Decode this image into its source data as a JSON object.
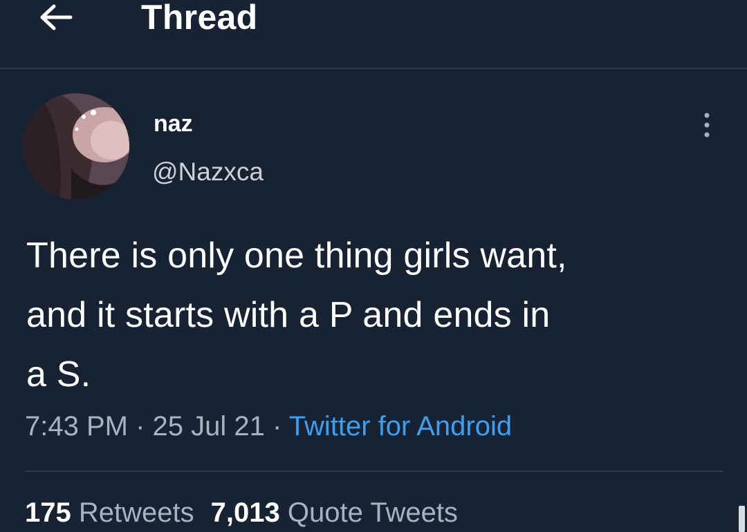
{
  "header": {
    "back_icon": "arrow-left-icon",
    "title": "Thread"
  },
  "tweet": {
    "author": {
      "name": "naz",
      "handle": "@Nazxca"
    },
    "more_icon": "more-vertical-icon",
    "text_lines": [
      "There is only one thing girls want,",
      "and it starts with a P and ends in",
      "a S."
    ],
    "time": "7:43 PM",
    "separator": "·",
    "date": "25 Jul 21",
    "source": "Twitter for Android",
    "stats": {
      "retweets_count": "175",
      "retweets_label": "Retweets",
      "quotes_count": "7,013",
      "quotes_label": "Quote Tweets"
    }
  },
  "colors": {
    "background": "#172233",
    "link": "#3e9ff0",
    "secondary_text": "#a8b3c0",
    "divider": "#2c3a4c"
  }
}
